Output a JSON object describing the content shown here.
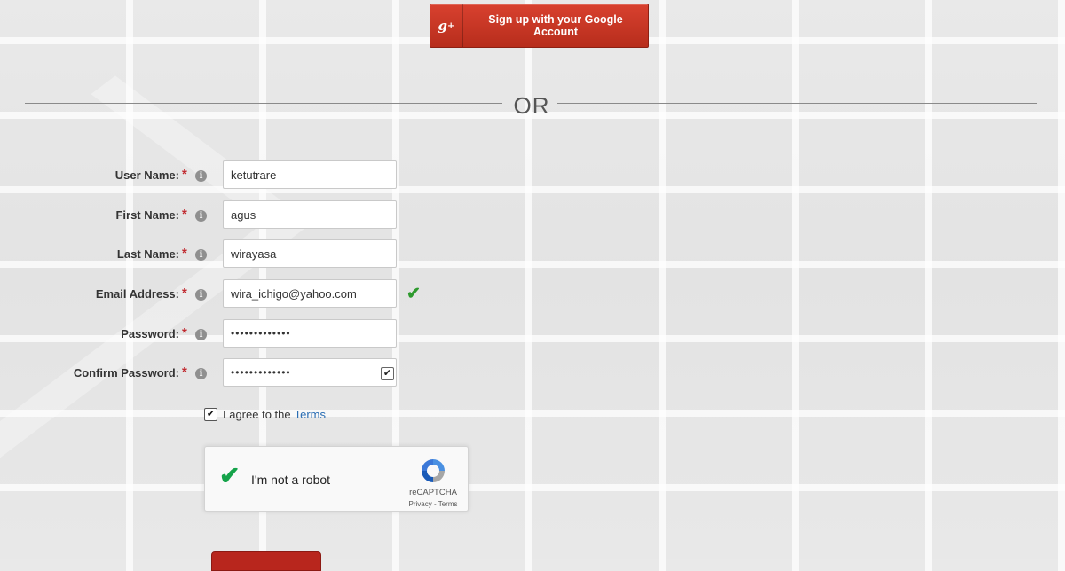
{
  "google_button": {
    "icon": "g+",
    "label": "Sign up with your Google Account"
  },
  "divider": {
    "text": "OR"
  },
  "fields": [
    {
      "label": "User Name:",
      "value": "ketutrare",
      "type": "text"
    },
    {
      "label": "First Name:",
      "value": "agus",
      "type": "text"
    },
    {
      "label": "Last Name:",
      "value": "wirayasa",
      "type": "text"
    },
    {
      "label": "Email Address:",
      "value": "wira_ichigo@yahoo.com",
      "type": "text"
    },
    {
      "label": "Password:",
      "value": "•••••••••••••",
      "type": "password"
    },
    {
      "label": "Confirm Password:",
      "value": "•••••••••••••",
      "type": "password"
    }
  ],
  "required_mark": "*",
  "info_glyph": "i",
  "terms": {
    "checked": true,
    "text": "I agree to the",
    "link": "Terms"
  },
  "recaptcha": {
    "checked": true,
    "label": "I'm not a robot",
    "brand": "reCAPTCHA",
    "links": "Privacy - Terms"
  },
  "colors": {
    "accent_red": "#c0272d",
    "link_blue": "#2a6db3",
    "valid_green": "#2e9a2e"
  }
}
